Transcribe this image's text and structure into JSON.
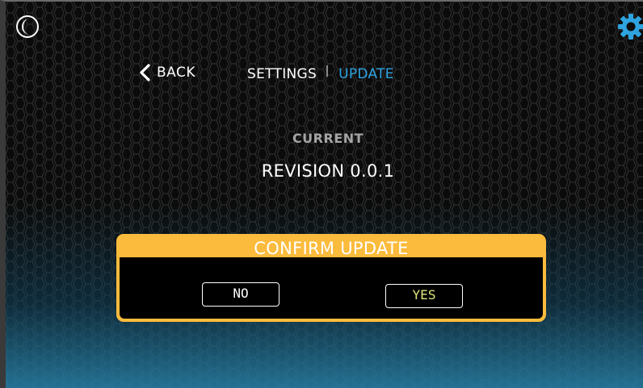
{
  "top": {
    "theme_icon": "moon-icon",
    "settings_icon": "gear-icon",
    "accent_color": "#2ea3e0"
  },
  "nav": {
    "back_label": "BACK",
    "breadcrumb": [
      "SETTINGS",
      "UPDATE"
    ]
  },
  "main": {
    "current_label": "CURRENT",
    "revision": "REVISION 0.0.1"
  },
  "dialog": {
    "title": "CONFIRM UPDATE",
    "no_label": "NO",
    "yes_label": "YES",
    "border_color": "#fbbb3c"
  }
}
